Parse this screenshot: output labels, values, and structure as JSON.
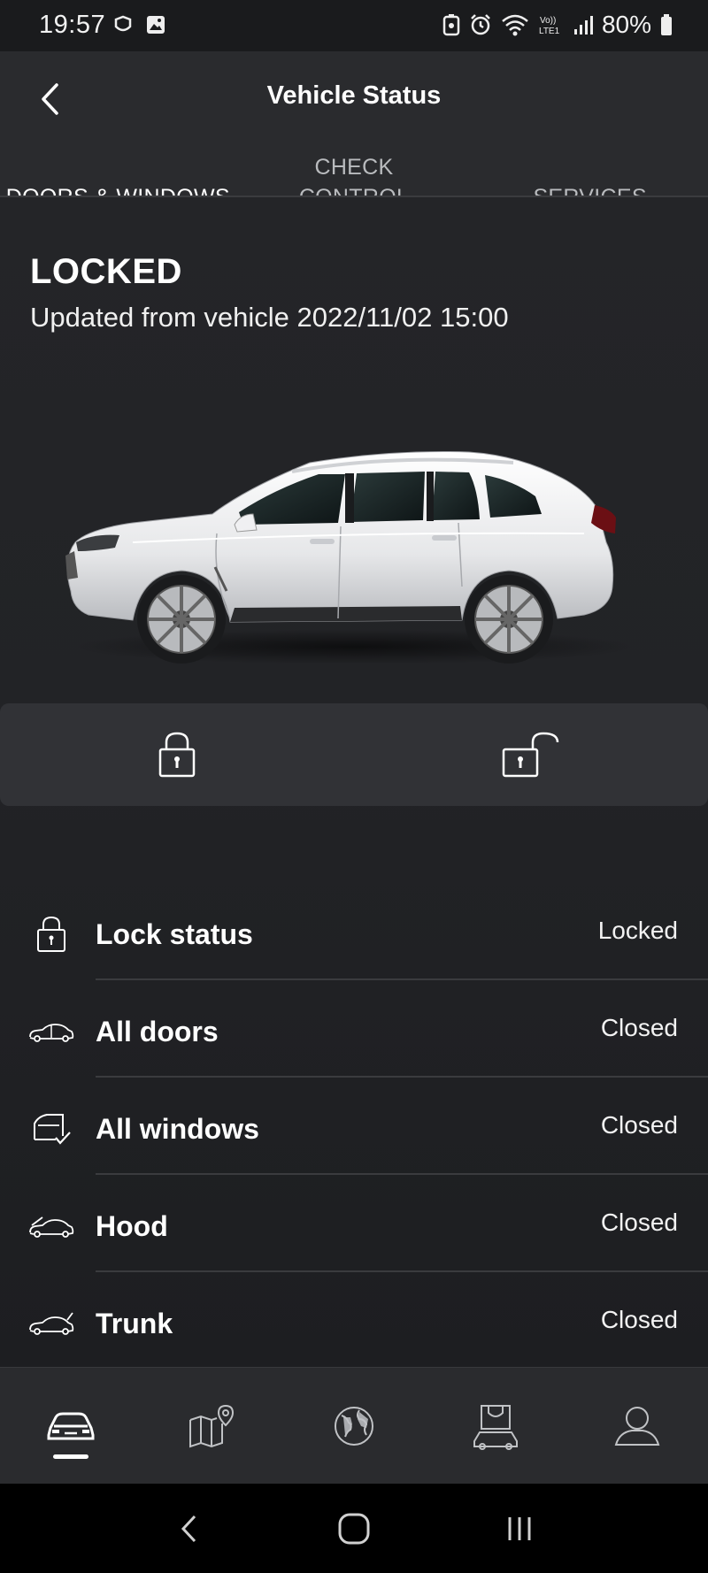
{
  "status_bar": {
    "time": "19:57",
    "battery": "80%",
    "icons": [
      "notification-icon",
      "gallery-icon",
      "data-saver-icon",
      "alarm-icon",
      "wifi-icon",
      "volte-icon",
      "signal-icon",
      "battery-icon"
    ]
  },
  "header": {
    "title": "Vehicle Status",
    "back_icon": "chevron-left-icon"
  },
  "tabs": [
    {
      "label": "DOORS & WINDOWS",
      "active": true
    },
    {
      "label": "CHECK CONTROL MESSAGES",
      "active": false
    },
    {
      "label": "SERVICES",
      "active": false
    }
  ],
  "vehicle": {
    "lock_state": "LOCKED",
    "updated": "Updated from vehicle 2022/11/02 15:00"
  },
  "lock_actions": [
    {
      "icon": "lock-closed-icon"
    },
    {
      "icon": "lock-open-icon"
    }
  ],
  "status_rows": [
    {
      "label": "Lock status",
      "value": "Locked",
      "icon": "lock-icon"
    },
    {
      "label": "All doors",
      "value": "Closed",
      "icon": "car-doors-icon"
    },
    {
      "label": "All windows",
      "value": "Closed",
      "icon": "window-check-icon"
    },
    {
      "label": "Hood",
      "value": "Closed",
      "icon": "car-hood-icon"
    },
    {
      "label": "Trunk",
      "value": "Closed",
      "icon": "car-trunk-icon"
    }
  ],
  "bottom_nav": [
    {
      "icon": "car-icon",
      "active": true
    },
    {
      "icon": "map-pin-icon",
      "active": false
    },
    {
      "icon": "globe-icon",
      "active": false
    },
    {
      "icon": "shop-car-icon",
      "active": false
    },
    {
      "icon": "profile-icon",
      "active": false
    }
  ],
  "colors": {
    "background": "#1c1d20",
    "header": "#2a2b2e",
    "accent": "#ffffff",
    "muted_text": "#b9bbbe"
  }
}
